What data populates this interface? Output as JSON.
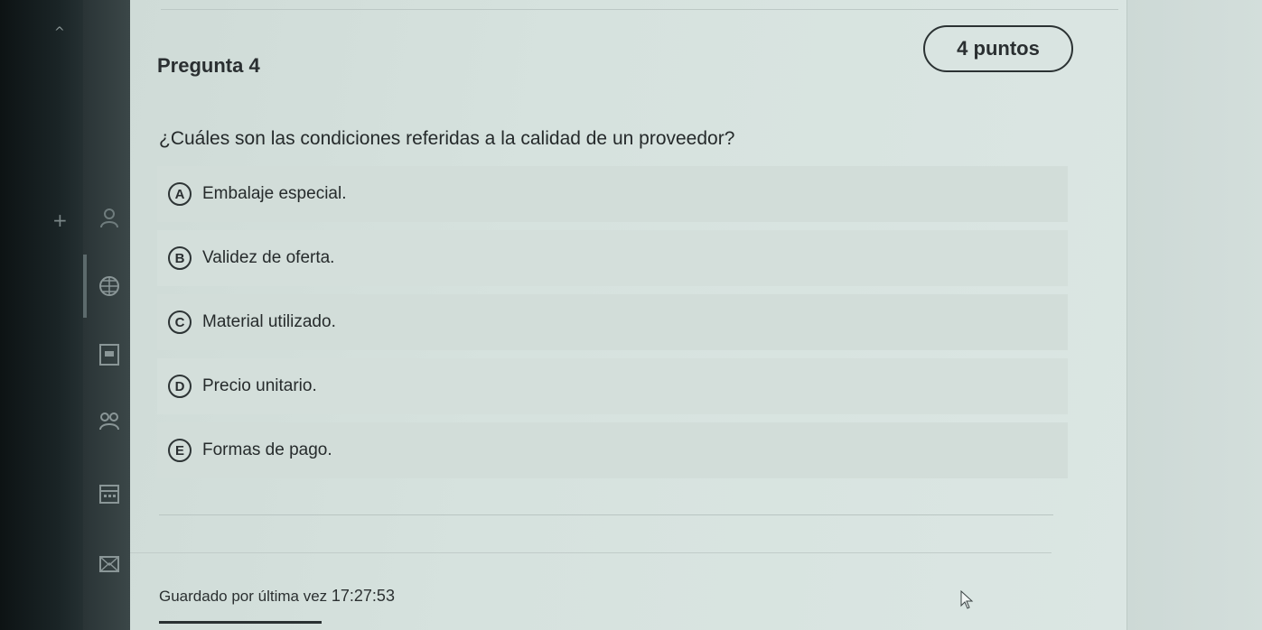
{
  "question": {
    "title": "Pregunta 4",
    "points": "4 puntos",
    "text": "¿Cuáles son las condiciones referidas a la calidad de un proveedor?"
  },
  "options": [
    {
      "letter": "A",
      "label": "Embalaje especial."
    },
    {
      "letter": "B",
      "label": "Validez de oferta."
    },
    {
      "letter": "C",
      "label": "Material utilizado."
    },
    {
      "letter": "D",
      "label": "Precio unitario."
    },
    {
      "letter": "E",
      "label": "Formas de pago."
    }
  ],
  "footer": {
    "saved_label": "Guardado por última vez",
    "saved_time": "17:27:53"
  },
  "rail_icons": [
    "user-icon",
    "globe-icon",
    "document-icon",
    "people-icon",
    "calendar-icon",
    "mail-icon"
  ],
  "colors": {
    "background": "#d6e2de",
    "text": "#2a2f31",
    "option_bg": "#d2ddd9"
  }
}
